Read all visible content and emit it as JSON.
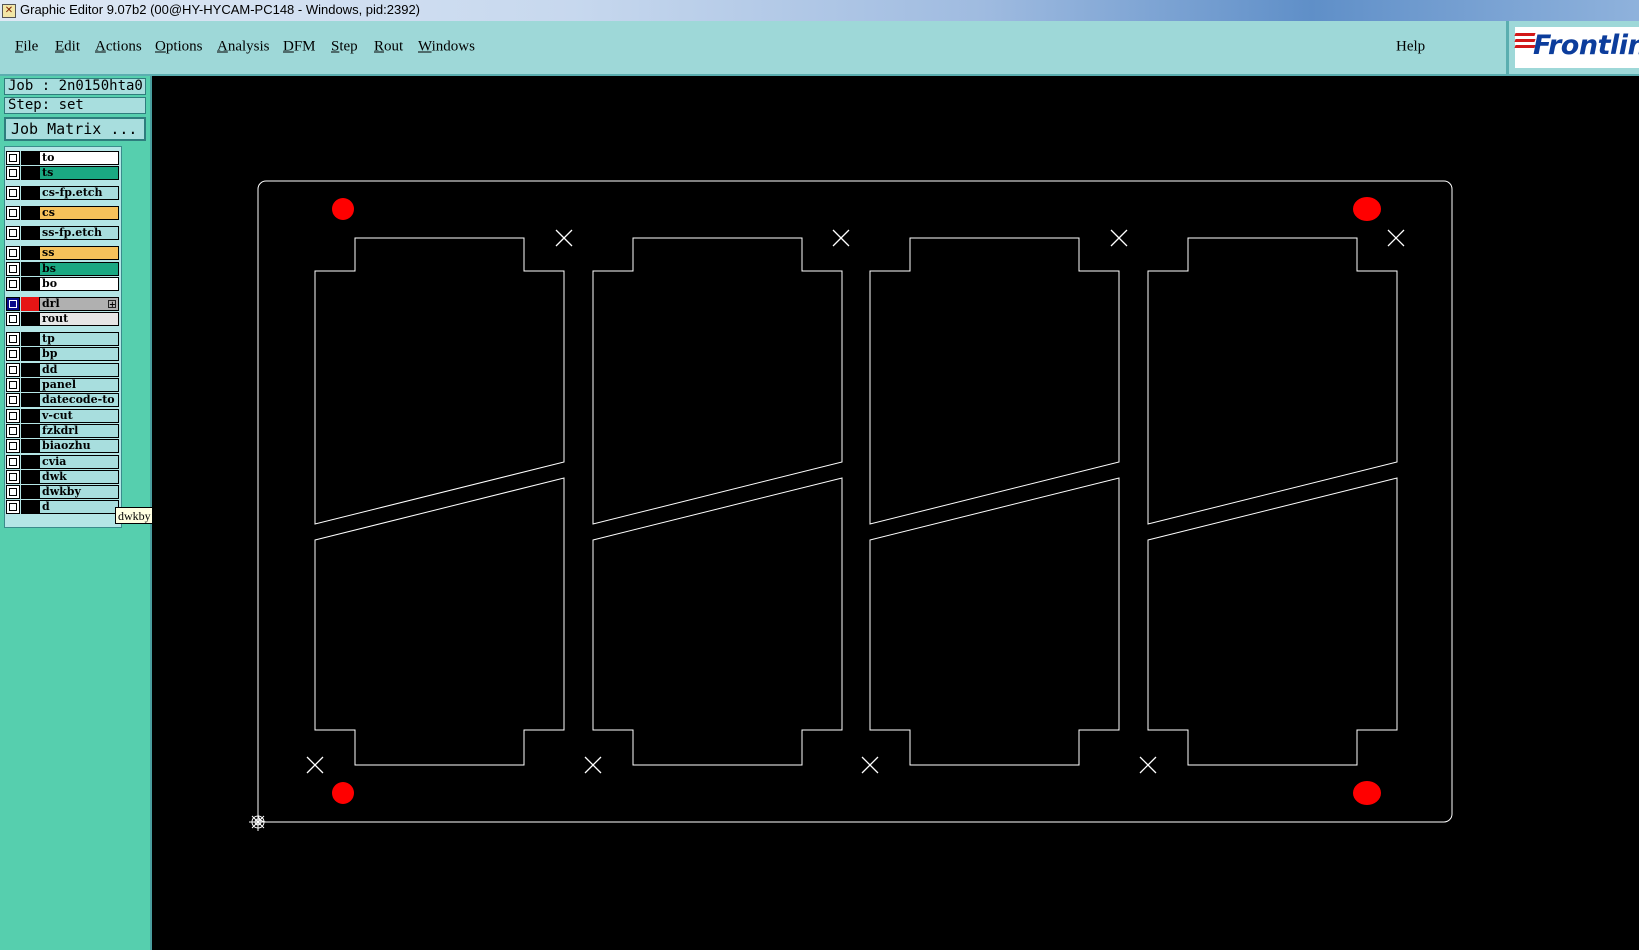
{
  "window": {
    "title": "Graphic Editor 9.07b2 (00@HY-HYCAM-PC148 - Windows, pid:2392)"
  },
  "menu": {
    "items": [
      {
        "first": "F",
        "rest": "ile"
      },
      {
        "first": "E",
        "rest": "dit"
      },
      {
        "first": "A",
        "rest": "ctions"
      },
      {
        "first": "O",
        "rest": "ptions"
      },
      {
        "first": "A",
        "rest": "nalysis"
      },
      {
        "first": "D",
        "rest": "FM"
      },
      {
        "first": "S",
        "rest": "tep"
      },
      {
        "first": "R",
        "rest": "out"
      },
      {
        "first": "W",
        "rest": "indows"
      }
    ],
    "help": "Help"
  },
  "brand": {
    "logo_text": "Frontline"
  },
  "job": {
    "job_line": "Job : 2n0150hta0",
    "step_line": "Step: set"
  },
  "job_matrix_button": "Job Matrix ...",
  "layers": [
    {
      "name": "to",
      "color": "#ffffff"
    },
    {
      "name": "ts",
      "color": "#1aa882"
    },
    {
      "name": "cs-fp.etch",
      "color": "#a8dede"
    },
    {
      "name": "cs",
      "color": "#f6c25a"
    },
    {
      "name": "ss-fp.etch",
      "color": "#a8dede"
    },
    {
      "name": "ss",
      "color": "#f6c25a"
    },
    {
      "name": "bs",
      "color": "#1aa882"
    },
    {
      "name": "bo",
      "color": "#ffffff"
    },
    {
      "name": "drl",
      "color": "#b0b0b0",
      "active": true
    },
    {
      "name": "rout",
      "color": "#e6e6e6"
    },
    {
      "name": "tp",
      "color": "#a8dede"
    },
    {
      "name": "bp",
      "color": "#a8dede"
    },
    {
      "name": "dd",
      "color": "#a8dede"
    },
    {
      "name": "panel",
      "color": "#a8dede"
    },
    {
      "name": "datecode-to",
      "color": "#a8dede"
    },
    {
      "name": "v-cut",
      "color": "#a8dede"
    },
    {
      "name": "fzkdrl",
      "color": "#a8dede"
    },
    {
      "name": "biaozhu",
      "color": "#a8dede"
    },
    {
      "name": "cvia",
      "color": "#a8dede"
    },
    {
      "name": "dwk",
      "color": "#a8dede"
    },
    {
      "name": "dwkby",
      "color": "#a8dede"
    },
    {
      "name": "d",
      "color": "#a8dede"
    }
  ],
  "tooltip": "dwkby – misc, drill, positive",
  "colors": {
    "menu_bg": "#9ed8d8",
    "panel_bg": "#56cfae",
    "canvas_bg": "#000000",
    "outline": "#ffffff",
    "fiducial": "#ff0000"
  }
}
